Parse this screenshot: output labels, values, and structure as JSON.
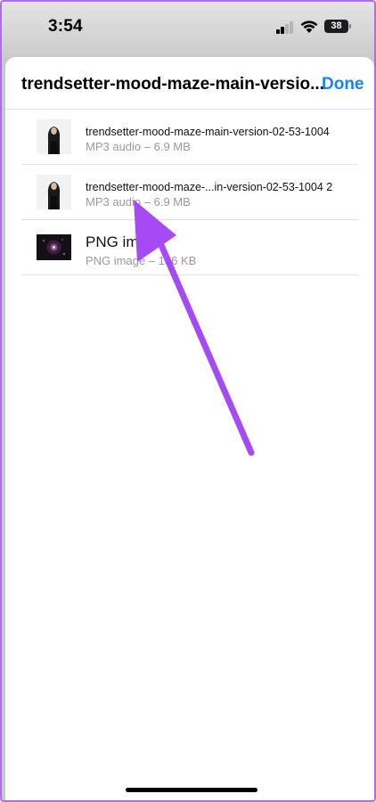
{
  "status_bar": {
    "time": "3:54",
    "battery": "38",
    "icons": [
      "signal-icon",
      "wifi-icon",
      "battery-icon"
    ]
  },
  "sheet": {
    "title": "trendsetter-mood-maze-main-versio...",
    "done_label": "Done"
  },
  "files": [
    {
      "name": "trendsetter-mood-maze-main-version-02-53-1004",
      "meta": "MP3 audio – 6.9 MB",
      "thumbnail": "person-photo"
    },
    {
      "name": "trendsetter-mood-maze-...in-version-02-53-1004 2",
      "meta": "MP3 audio – 6.9 MB",
      "thumbnail": "person-photo"
    },
    {
      "name": "PNG image",
      "meta": "PNG image – 156 KB",
      "thumbnail": "dark-artwork"
    }
  ],
  "annotation": {
    "arrow_color": "#a64bf4"
  },
  "colors": {
    "accent": "#1a82f5",
    "frame": "#b06cf0"
  }
}
